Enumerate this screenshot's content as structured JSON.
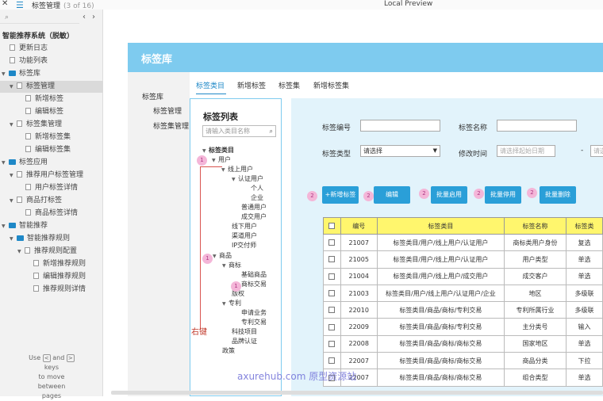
{
  "topbar": {
    "page_title": "标签管理",
    "page_count": "(3 of 16)",
    "preview_title": "Local Preview"
  },
  "sidebar": {
    "app_title": "智能推荐系统（脱敏）",
    "items": [
      {
        "label": "更新日志"
      },
      {
        "label": "功能列表"
      },
      {
        "label": "标签库"
      },
      {
        "label": "标签管理"
      },
      {
        "label": "新增标签"
      },
      {
        "label": "编辑标签"
      },
      {
        "label": "标签集管理"
      },
      {
        "label": "新增标签集"
      },
      {
        "label": "编辑标签集"
      },
      {
        "label": "标签应用"
      },
      {
        "label": "推荐用户标签管理"
      },
      {
        "label": "用户标签详情"
      },
      {
        "label": "商品打标签"
      },
      {
        "label": "商品标签详情"
      },
      {
        "label": "智能推荐"
      },
      {
        "label": "智能推荐规则"
      },
      {
        "label": "推荐规则配置"
      },
      {
        "label": "新增推荐规则"
      },
      {
        "label": "编辑推荐规则"
      },
      {
        "label": "推荐规则详情"
      }
    ],
    "hint": {
      "use": "Use",
      "key_left": "<",
      "and": "and",
      "key_right": ">",
      "keys": "keys",
      "rest": "to move between",
      "pages": "pages"
    }
  },
  "main": {
    "banner_title": "标签库",
    "left_nav": [
      "标签库",
      "标签管理",
      "标签集管理"
    ],
    "tabs": [
      "标签类目",
      "新增标签",
      "标签集",
      "新增标签集"
    ],
    "panel_title": "标签列表",
    "panel_search_placeholder": "请输入类目名称",
    "tree": [
      "标签类目",
      "用户",
      "线上用户",
      "认证用户",
      "个人",
      "企业",
      "普通用户",
      "成交用户",
      "线下用户",
      "渠道用户",
      "IP交付师",
      "商品",
      "商标",
      "基础商品",
      "商标交易",
      "版权",
      "专利",
      "申请业务",
      "专利交易",
      "科技项目",
      "品牌认证",
      "政策"
    ],
    "annotation_right_click": "右键",
    "badges": [
      "1",
      "1",
      "1",
      "2",
      "2",
      "2",
      "2",
      "2"
    ],
    "filters": {
      "tag_no_label": "标签编号",
      "tag_name_label": "标签名称",
      "tag_type_label": "标签类型",
      "tag_type_value": "请选择",
      "modify_time_label": "修改时间",
      "start_date_placeholder": "请选择起始日期",
      "dash": "-",
      "end_date_placeholder": "请选"
    },
    "buttons": [
      "+新增标签",
      "编辑",
      "批量启用",
      "批量停用",
      "批量删除"
    ],
    "table": {
      "headers": [
        "",
        "编号",
        "标签类目",
        "标签名称",
        "标签类"
      ],
      "rows": [
        [
          "21007",
          "标签类目/用户/线上用户/认证用户",
          "商标类用户身份",
          "复选"
        ],
        [
          "21005",
          "标签类目/用户/线上用户/认证用户",
          "用户类型",
          "单选"
        ],
        [
          "21004",
          "标签类目/用户/线上用户/成交用户",
          "成交客户",
          "单选"
        ],
        [
          "21003",
          "标签类目/用户/线上用户/认证用户/企业",
          "地区",
          "多级联"
        ],
        [
          "22010",
          "标签类目/商品/商标/专利交易",
          "专利所属行业",
          "多级联"
        ],
        [
          "22009",
          "标签类目/商品/商标/专利交易",
          "主分类号",
          "输入"
        ],
        [
          "22008",
          "标签类目/商品/商标/商标交易",
          "国家地区",
          "单选"
        ],
        [
          "22007",
          "标签类目/商品/商标/商标交易",
          "商品分类",
          "下拉"
        ],
        [
          "22007",
          "标签类目/商品/商标/商标交易",
          "组合类型",
          "单选"
        ]
      ]
    },
    "watermark": "axurehub.com 原型资源站"
  }
}
